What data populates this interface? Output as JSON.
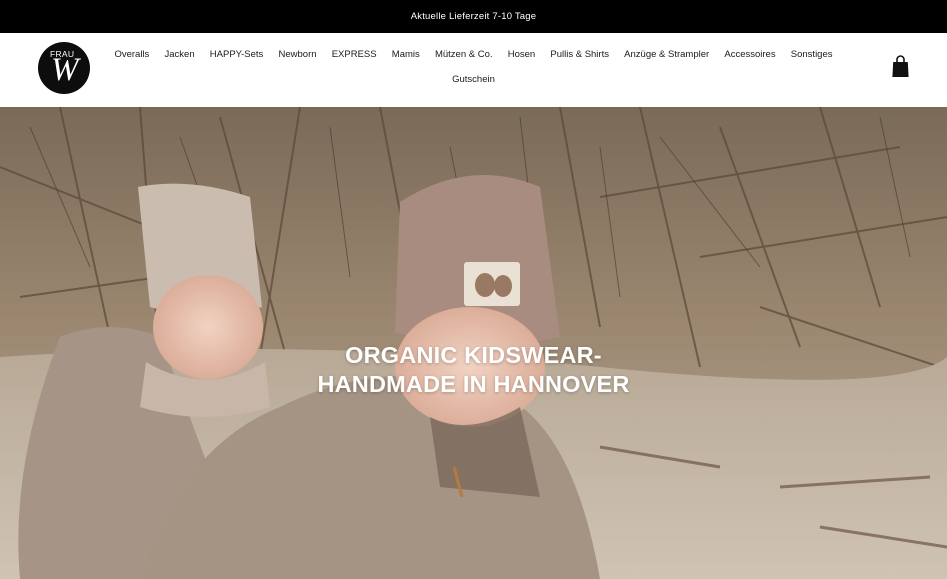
{
  "announcement": {
    "text": "Aktuelle Lieferzeit  7-10 Tage"
  },
  "logo": {
    "top_text": "FRAU",
    "letter": "W"
  },
  "nav": {
    "row1": [
      "Overalls",
      "Jacken",
      "HAPPY-Sets",
      "Newborn",
      "EXPRESS",
      "Mamis",
      "Mützen & Co.",
      "Hosen",
      "Pullis & Shirts",
      "Anzüge & Strampler",
      "Accessoires",
      "Sonstiges"
    ],
    "row2": [
      "Gutschein"
    ]
  },
  "cart": {
    "icon": "shopping-bag-icon"
  },
  "hero": {
    "title_line1": "ORGANIC KIDSWEAR-",
    "title_line2": "HANDMADE IN HANNOVER"
  },
  "colors": {
    "announcement_bg": "#000000",
    "announcement_text": "#ffffff",
    "nav_text": "#1a1a1a"
  }
}
